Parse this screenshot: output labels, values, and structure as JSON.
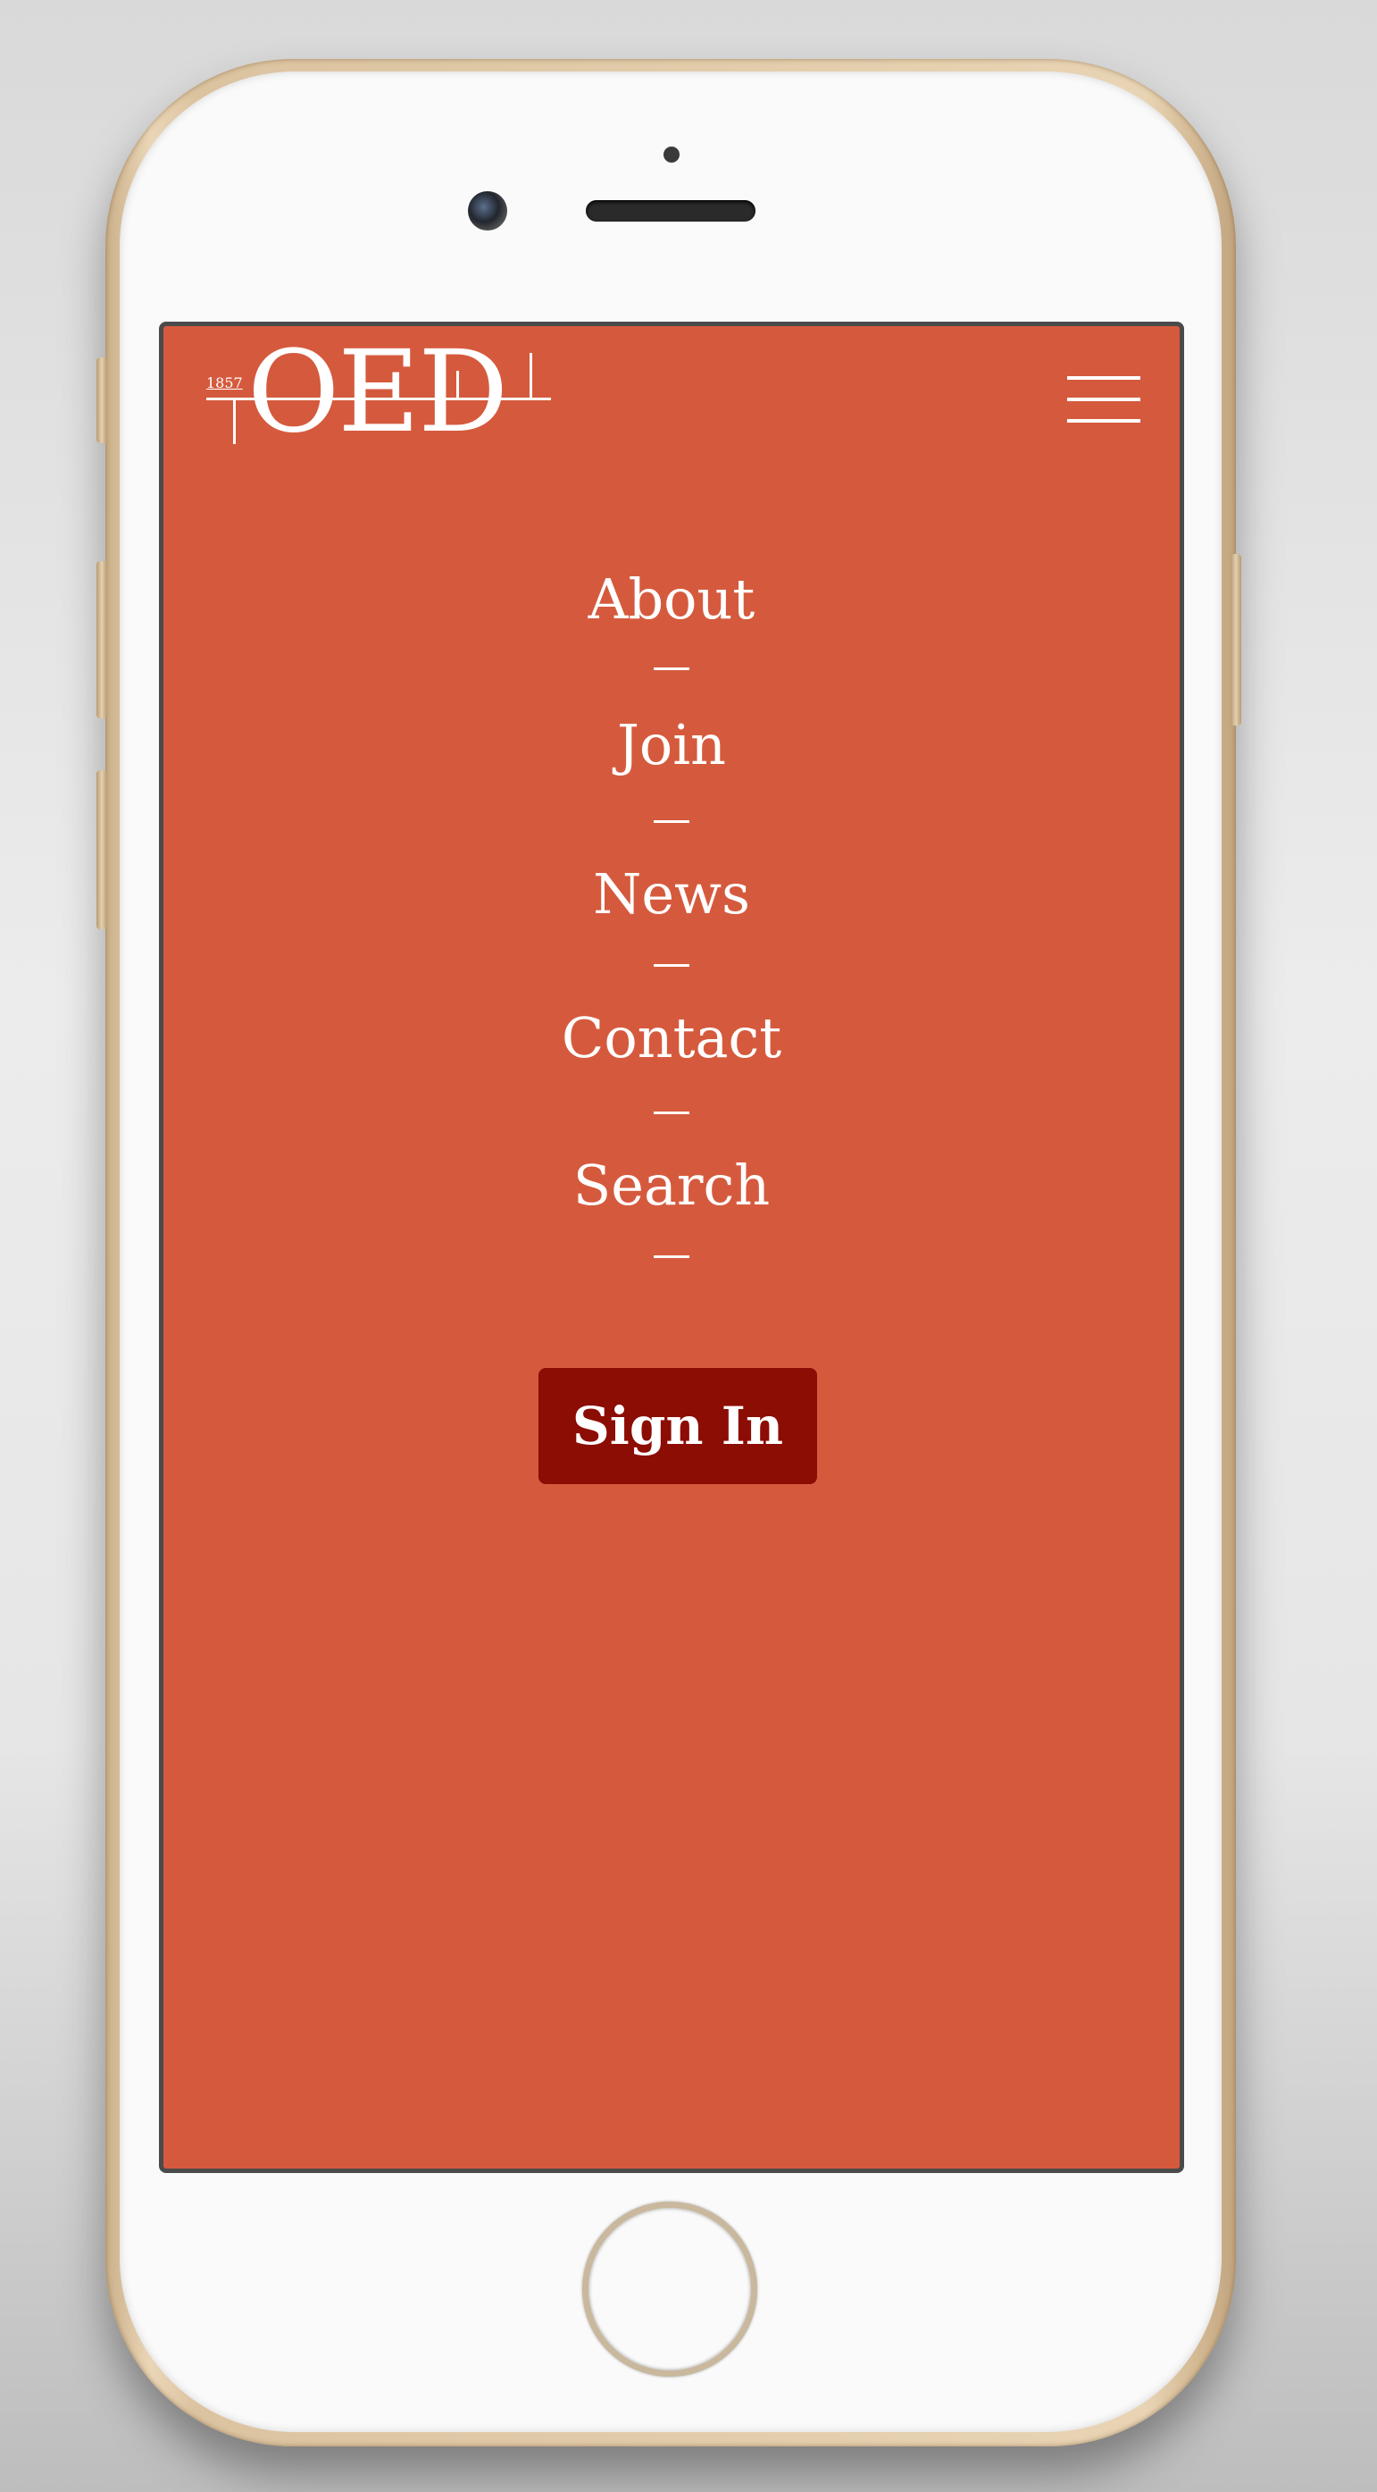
{
  "header": {
    "logo_text": "OED",
    "logo_year": "1857",
    "menu_icon": "hamburger-menu-icon"
  },
  "nav": {
    "items": [
      {
        "label": "About"
      },
      {
        "label": "Join"
      },
      {
        "label": "News"
      },
      {
        "label": "Contact"
      },
      {
        "label": "Search"
      }
    ],
    "separator": "—"
  },
  "signin": {
    "label": "Sign In"
  },
  "colors": {
    "screen_background": "#d55a3d",
    "signin_background": "#8c0d04",
    "text": "#ffffff",
    "phone_frame": "#e8d4b4"
  }
}
